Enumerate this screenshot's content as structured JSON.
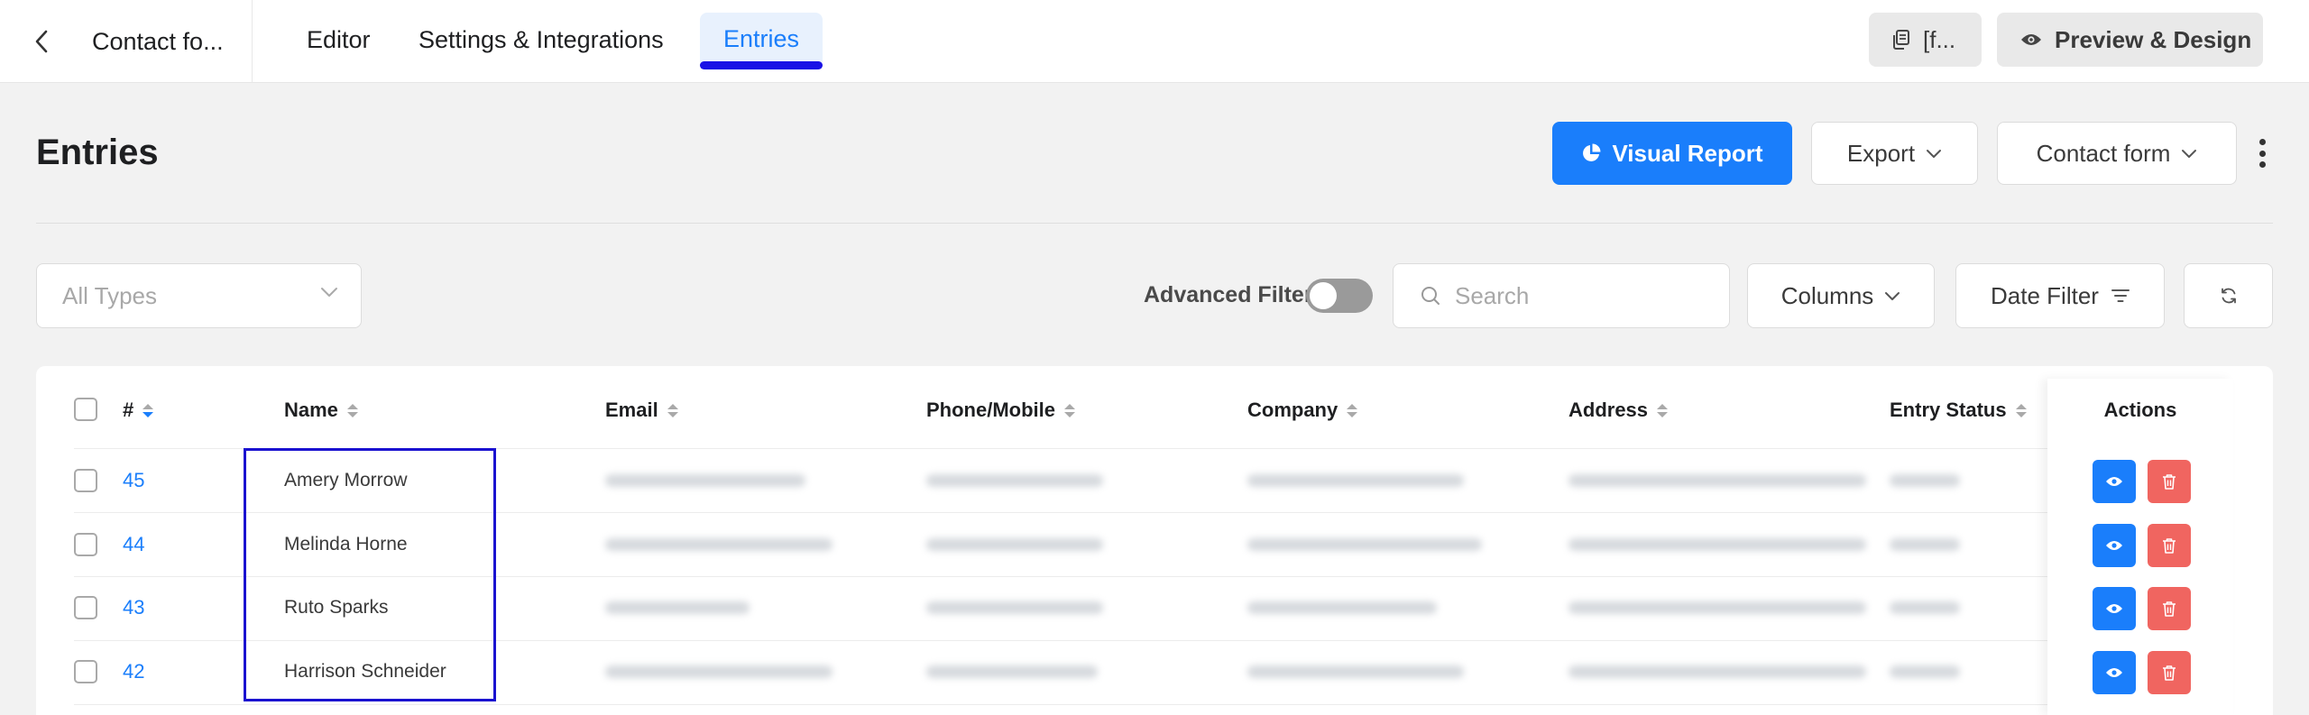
{
  "topbar": {
    "form_title": "Contact fo...",
    "tabs": [
      "Editor",
      "Settings & Integrations",
      "Entries"
    ],
    "shortcode_label": "[f...",
    "preview_label": "Preview & Design"
  },
  "page": {
    "title": "Entries",
    "visual_report_label": "Visual Report",
    "export_label": "Export",
    "form_select_label": "Contact form"
  },
  "filters": {
    "types_placeholder": "All Types",
    "advanced_filter_label": "Advanced Filter",
    "advanced_filter_on": false,
    "search_placeholder": "Search",
    "columns_label": "Columns",
    "date_filter_label": "Date Filter"
  },
  "table": {
    "headers": {
      "id": "#",
      "name": "Name",
      "email": "Email",
      "phone": "Phone/Mobile",
      "company": "Company",
      "address": "Address",
      "status": "Entry Status",
      "actions": "Actions"
    },
    "rows": [
      {
        "id": "45",
        "name": "Amery Morrow"
      },
      {
        "id": "44",
        "name": "Melinda Horne"
      },
      {
        "id": "43",
        "name": "Ruto Sparks"
      },
      {
        "id": "42",
        "name": "Harrison Schneider"
      }
    ]
  },
  "colors": {
    "accent": "#1a7efb",
    "delete": "#f06560",
    "highlight_border": "#1a12d0"
  }
}
